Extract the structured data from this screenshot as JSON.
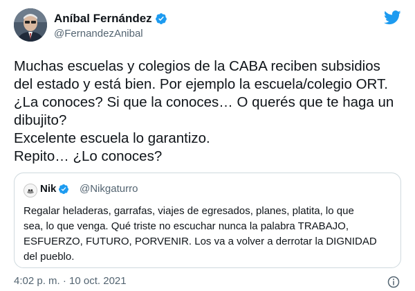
{
  "author": {
    "display_name": "Aníbal Fernández",
    "handle": "@FernandezAnibal"
  },
  "tweet": {
    "lines": [
      "Muchas escuelas y colegios de la CABA reciben subsidios",
      "del estado y está bien. Por ejemplo la escuela/colegio ORT.",
      "¿La conoces? Si que la conoces… O querés que te haga un",
      "dibujito?",
      "Excelente escuela lo garantizo.",
      "Repito… ¿Lo conoces?"
    ]
  },
  "quoted_tweet": {
    "display_name": "Nik",
    "handle": "@Nikgaturro",
    "lines": [
      "Regalar heladeras, garrafas, viajes de egresados, planes, platita, lo que",
      "sea, lo que venga. Qué triste no escuchar nunca la palabra TRABAJO,",
      "ESFUERZO, FUTURO, PORVENIR. Los va a volver a derrotar la DIGNIDAD",
      "del pueblo."
    ]
  },
  "timestamp": "4:02 p. m. · 10 oct. 2021",
  "colors": {
    "twitter_blue": "#1d9bf0",
    "text": "#0f1419",
    "secondary": "#536471",
    "border": "#cfd9de"
  },
  "icons": [
    "twitter-bird-icon",
    "verified-badge-icon",
    "info-icon"
  ]
}
